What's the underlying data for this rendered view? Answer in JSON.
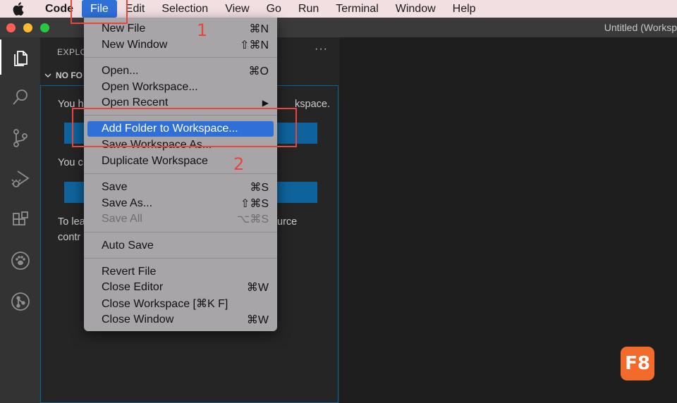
{
  "menubar": {
    "app_name": "Code",
    "items": [
      "File",
      "Edit",
      "Selection",
      "View",
      "Go",
      "Run",
      "Terminal",
      "Window",
      "Help"
    ],
    "active": "File"
  },
  "window": {
    "title": "Untitled (Worksp"
  },
  "sidebar": {
    "title": "EXPLO",
    "more": "···",
    "section": "NO FO",
    "lines": [
      {
        "left": "You h",
        "right": "kspace."
      },
      {
        "left": "You c",
        "right": ""
      },
      {
        "left": "To lea",
        "right": "urce"
      },
      {
        "left": "contr",
        "right": ""
      }
    ]
  },
  "file_menu": {
    "items": [
      {
        "label": "New File",
        "shortcut": "⌘N"
      },
      {
        "label": "New Window",
        "shortcut": "⇧⌘N"
      },
      {
        "label": "Open...",
        "shortcut": "⌘O"
      },
      {
        "label": "Open Workspace...",
        "shortcut": ""
      },
      {
        "label": "Open Recent",
        "shortcut": "▶"
      },
      {
        "label": "Add Folder to Workspace...",
        "shortcut": "",
        "highlighted": true
      },
      {
        "label": "Save Workspace As...",
        "shortcut": ""
      },
      {
        "label": "Duplicate Workspace",
        "shortcut": ""
      },
      {
        "label": "Save",
        "shortcut": "⌘S"
      },
      {
        "label": "Save As...",
        "shortcut": "⇧⌘S"
      },
      {
        "label": "Save All",
        "shortcut": "⌥⌘S",
        "disabled": true
      },
      {
        "label": "Auto Save",
        "shortcut": ""
      },
      {
        "label": "Revert File",
        "shortcut": ""
      },
      {
        "label": "Close Editor",
        "shortcut": "⌘W"
      },
      {
        "label": "Close Workspace [⌘K F]",
        "shortcut": ""
      },
      {
        "label": "Close Window",
        "shortcut": "⌘W"
      }
    ]
  },
  "annotations": {
    "step1": "1",
    "step2": "2"
  },
  "badge": {
    "text": "F8"
  },
  "colors": {
    "highlight": "#2f6fd8",
    "annotation": "#e8453c",
    "badge": "#f26b2a",
    "button": "#0e639c"
  }
}
